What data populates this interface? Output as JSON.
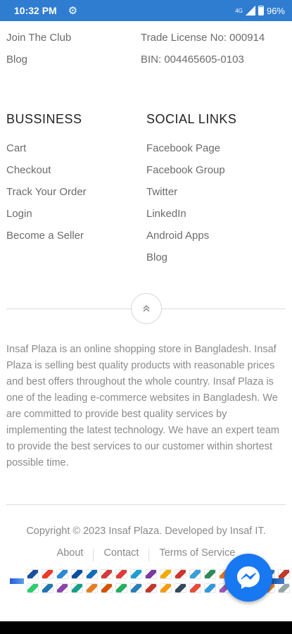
{
  "status_bar": {
    "time": "10:32 PM",
    "network": "4G",
    "battery": "96%"
  },
  "left_top_links": [
    "Join The Club",
    "Blog"
  ],
  "company_info": [
    "Trade License No: 000914",
    "BIN: 004465605-0103"
  ],
  "business": {
    "heading": "BUSSINESS",
    "links": [
      "Cart",
      "Checkout",
      "Track Your Order",
      "Login",
      "Become a Seller"
    ]
  },
  "social": {
    "heading": "SOCIAL LINKS",
    "links": [
      "Facebook Page",
      "Facebook Group",
      "Twitter",
      "LinkedIn",
      "Android Apps",
      "Blog"
    ]
  },
  "about_text": "Insaf Plaza is an online shopping store in Bangladesh. Insaf Plaza is selling best quality products with reasonable prices and best offers throughout the whole country. Insaf Plaza is one of the leading e-commerce websites in Bangladesh. We are committed to provide best quality services by implementing the latest technology. We have an expert team to provide the best services to our customer within shortest possible time.",
  "copyright": "Copyright © 2023 Insaf Plaza. Developed by Insaf IT.",
  "footer_links": [
    "About",
    "Contact",
    "Terms of Service"
  ],
  "payment_colors": [
    "#1a4fa0",
    "#eb3b2a",
    "#2a8ad6",
    "#0b4ea2",
    "#0f6fb7",
    "#d23c3c",
    "#e23a3a",
    "#1b9fd0",
    "#7a3aa0",
    "#f2a900",
    "#d0342c",
    "#3aa0d6",
    "#2e8b57",
    "#e07a2e",
    "#1a6aa8",
    "#f5b400",
    "#2c7fbf",
    "#c0392b",
    "#2ecc71",
    "#1f77b4",
    "#8e44ad",
    "#16a085",
    "#e67e22",
    "#d35400",
    "#27ae60",
    "#2980b9",
    "#c0392b",
    "#f39c12",
    "#34495e",
    "#e74c3c",
    "#3498db",
    "#9b59b6",
    "#1abc9c",
    "#f1c40f",
    "#e67e22",
    "#95a5a6"
  ]
}
